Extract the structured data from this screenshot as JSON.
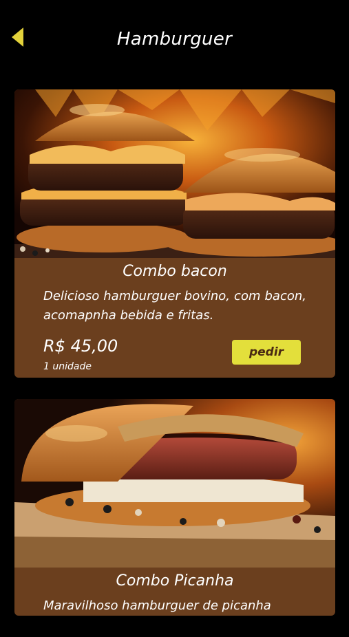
{
  "header": {
    "title": "Hamburguer",
    "back_icon": "chevron-left-icon"
  },
  "colors": {
    "background": "#000000",
    "card": "#6b3f1e",
    "button": "#e3df3b",
    "back_icon": "#e3d23b"
  },
  "products": [
    {
      "name": "Combo bacon",
      "description": "Delicioso hamburguer bovino, com bacon, acomapnha bebida e fritas.",
      "price": "R$ 45,00",
      "unit": "1 unidade",
      "button_label": "pedir"
    },
    {
      "name": "Combo Picanha",
      "description": "Maravilhoso hamburguer de picanha"
    }
  ]
}
